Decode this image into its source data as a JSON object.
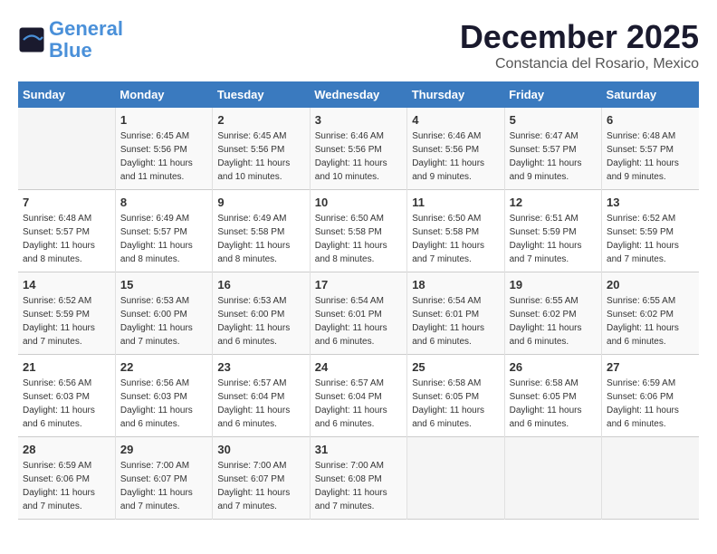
{
  "header": {
    "logo_line1": "General",
    "logo_line2": "Blue",
    "month": "December 2025",
    "location": "Constancia del Rosario, Mexico"
  },
  "days_of_week": [
    "Sunday",
    "Monday",
    "Tuesday",
    "Wednesday",
    "Thursday",
    "Friday",
    "Saturday"
  ],
  "weeks": [
    [
      {
        "day": "",
        "info": ""
      },
      {
        "day": "1",
        "info": "Sunrise: 6:45 AM\nSunset: 5:56 PM\nDaylight: 11 hours\nand 11 minutes."
      },
      {
        "day": "2",
        "info": "Sunrise: 6:45 AM\nSunset: 5:56 PM\nDaylight: 11 hours\nand 10 minutes."
      },
      {
        "day": "3",
        "info": "Sunrise: 6:46 AM\nSunset: 5:56 PM\nDaylight: 11 hours\nand 10 minutes."
      },
      {
        "day": "4",
        "info": "Sunrise: 6:46 AM\nSunset: 5:56 PM\nDaylight: 11 hours\nand 9 minutes."
      },
      {
        "day": "5",
        "info": "Sunrise: 6:47 AM\nSunset: 5:57 PM\nDaylight: 11 hours\nand 9 minutes."
      },
      {
        "day": "6",
        "info": "Sunrise: 6:48 AM\nSunset: 5:57 PM\nDaylight: 11 hours\nand 9 minutes."
      }
    ],
    [
      {
        "day": "7",
        "info": "Sunrise: 6:48 AM\nSunset: 5:57 PM\nDaylight: 11 hours\nand 8 minutes."
      },
      {
        "day": "8",
        "info": "Sunrise: 6:49 AM\nSunset: 5:57 PM\nDaylight: 11 hours\nand 8 minutes."
      },
      {
        "day": "9",
        "info": "Sunrise: 6:49 AM\nSunset: 5:58 PM\nDaylight: 11 hours\nand 8 minutes."
      },
      {
        "day": "10",
        "info": "Sunrise: 6:50 AM\nSunset: 5:58 PM\nDaylight: 11 hours\nand 8 minutes."
      },
      {
        "day": "11",
        "info": "Sunrise: 6:50 AM\nSunset: 5:58 PM\nDaylight: 11 hours\nand 7 minutes."
      },
      {
        "day": "12",
        "info": "Sunrise: 6:51 AM\nSunset: 5:59 PM\nDaylight: 11 hours\nand 7 minutes."
      },
      {
        "day": "13",
        "info": "Sunrise: 6:52 AM\nSunset: 5:59 PM\nDaylight: 11 hours\nand 7 minutes."
      }
    ],
    [
      {
        "day": "14",
        "info": "Sunrise: 6:52 AM\nSunset: 5:59 PM\nDaylight: 11 hours\nand 7 minutes."
      },
      {
        "day": "15",
        "info": "Sunrise: 6:53 AM\nSunset: 6:00 PM\nDaylight: 11 hours\nand 7 minutes."
      },
      {
        "day": "16",
        "info": "Sunrise: 6:53 AM\nSunset: 6:00 PM\nDaylight: 11 hours\nand 6 minutes."
      },
      {
        "day": "17",
        "info": "Sunrise: 6:54 AM\nSunset: 6:01 PM\nDaylight: 11 hours\nand 6 minutes."
      },
      {
        "day": "18",
        "info": "Sunrise: 6:54 AM\nSunset: 6:01 PM\nDaylight: 11 hours\nand 6 minutes."
      },
      {
        "day": "19",
        "info": "Sunrise: 6:55 AM\nSunset: 6:02 PM\nDaylight: 11 hours\nand 6 minutes."
      },
      {
        "day": "20",
        "info": "Sunrise: 6:55 AM\nSunset: 6:02 PM\nDaylight: 11 hours\nand 6 minutes."
      }
    ],
    [
      {
        "day": "21",
        "info": "Sunrise: 6:56 AM\nSunset: 6:03 PM\nDaylight: 11 hours\nand 6 minutes."
      },
      {
        "day": "22",
        "info": "Sunrise: 6:56 AM\nSunset: 6:03 PM\nDaylight: 11 hours\nand 6 minutes."
      },
      {
        "day": "23",
        "info": "Sunrise: 6:57 AM\nSunset: 6:04 PM\nDaylight: 11 hours\nand 6 minutes."
      },
      {
        "day": "24",
        "info": "Sunrise: 6:57 AM\nSunset: 6:04 PM\nDaylight: 11 hours\nand 6 minutes."
      },
      {
        "day": "25",
        "info": "Sunrise: 6:58 AM\nSunset: 6:05 PM\nDaylight: 11 hours\nand 6 minutes."
      },
      {
        "day": "26",
        "info": "Sunrise: 6:58 AM\nSunset: 6:05 PM\nDaylight: 11 hours\nand 6 minutes."
      },
      {
        "day": "27",
        "info": "Sunrise: 6:59 AM\nSunset: 6:06 PM\nDaylight: 11 hours\nand 6 minutes."
      }
    ],
    [
      {
        "day": "28",
        "info": "Sunrise: 6:59 AM\nSunset: 6:06 PM\nDaylight: 11 hours\nand 7 minutes."
      },
      {
        "day": "29",
        "info": "Sunrise: 7:00 AM\nSunset: 6:07 PM\nDaylight: 11 hours\nand 7 minutes."
      },
      {
        "day": "30",
        "info": "Sunrise: 7:00 AM\nSunset: 6:07 PM\nDaylight: 11 hours\nand 7 minutes."
      },
      {
        "day": "31",
        "info": "Sunrise: 7:00 AM\nSunset: 6:08 PM\nDaylight: 11 hours\nand 7 minutes."
      },
      {
        "day": "",
        "info": ""
      },
      {
        "day": "",
        "info": ""
      },
      {
        "day": "",
        "info": ""
      }
    ]
  ]
}
